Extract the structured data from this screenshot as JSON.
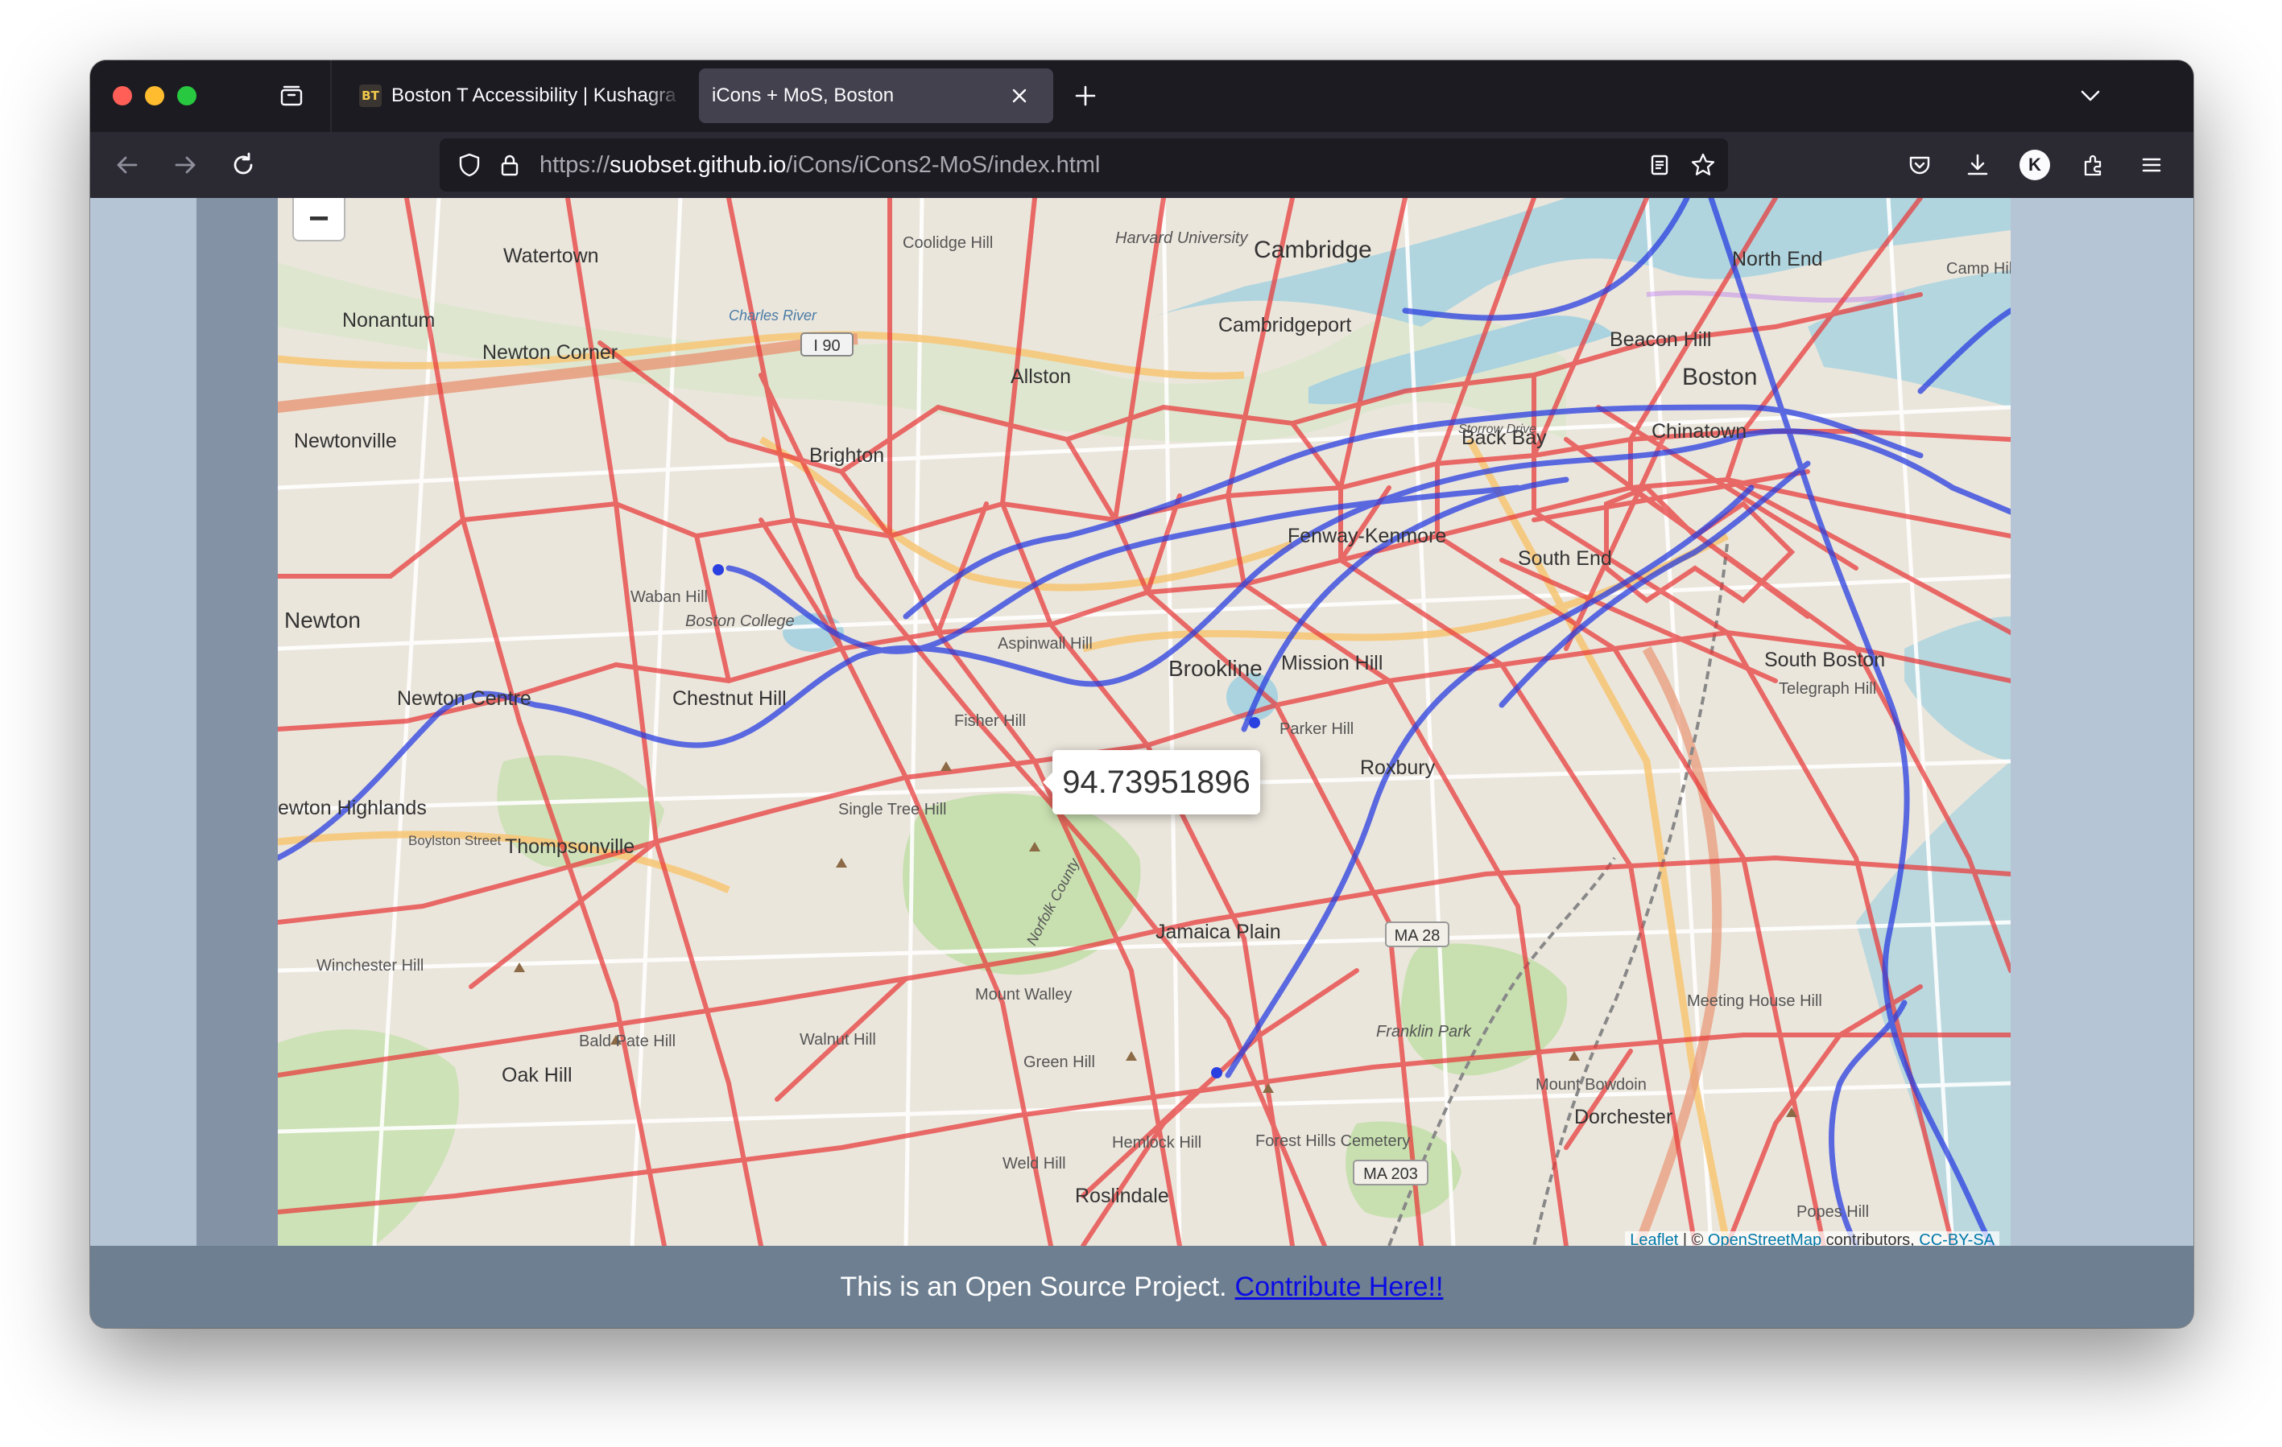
{
  "browser": {
    "tabs": [
      {
        "title": "Boston T Accessibility | Kushagra",
        "favicon": "tab-favicon",
        "active": false
      },
      {
        "title": "iCons + MoS, Boston",
        "active": true
      }
    ],
    "url": {
      "prefix": "https://",
      "host": "suobset.github.io",
      "path": "/iCons/iCons2-MoS/index.html"
    },
    "icons": [
      "tab-overview-icon",
      "new-tab-icon",
      "tab-list-icon",
      "back-icon",
      "forward-icon",
      "reload-icon",
      "shield-icon",
      "lock-icon",
      "reader-view-icon",
      "bookmark-star-icon",
      "pocket-icon",
      "download-icon",
      "account-avatar-icon",
      "extensions-icon",
      "menu-icon"
    ],
    "avatar_letter": "K"
  },
  "map": {
    "zoom_out_label": "−",
    "tooltip_value": "94.73951896",
    "labels": {
      "watertown": "Watertown",
      "nonantum": "Nonantum",
      "newton_corner": "Newton Corner",
      "newtonville": "Newtonville",
      "newton": "Newton",
      "newton_centre": "Newton Centre",
      "newton_highlands": "ewton Highlands",
      "thompsonville": "Thompsonville",
      "chestnut_hill": "Chestnut Hill",
      "brighton": "Brighton",
      "allston": "Allston",
      "cambridge": "Cambridge",
      "cambridgeport": "Cambridgeport",
      "harvard_university": "Harvard University",
      "beacon_hill": "Beacon Hill",
      "north_end": "North End",
      "boston": "Boston",
      "back_bay": "Back Bay",
      "chinatown": "Chinatown",
      "fenway_kenmore": "Fenway-Kenmore",
      "south_end": "South End",
      "brookline": "Brookline",
      "mission_hill": "Mission Hill",
      "roxbury": "Roxbury",
      "south_boston": "South Boston",
      "jamaica_plain": "Jamaica Plain",
      "oak_hill": "Oak Hill",
      "dorchester": "Dorchester",
      "roslindale": "Roslindale",
      "winchester_hill": "Winchester Hill",
      "bald_pate_hill": "Bald Pate Hill",
      "walnut_hill": "Walnut Hill",
      "green_hill": "Green Hill",
      "mount_walley": "Mount Walley",
      "weld_hill": "Weld Hill",
      "hemlock_hill": "Hemlock Hill",
      "forest_hills_cemetery": "Forest Hills Cemetery",
      "franklin_park": "Franklin Park",
      "meeting_house_hill": "Meeting House Hill",
      "mount_bowdoin": "Mount Bowdoin",
      "single_tree_hill": "Single Tree Hill",
      "fisher_hill": "Fisher Hill",
      "aspinwall_hill": "Aspinwall Hill",
      "waban_hill": "Waban Hill",
      "boston_college": "Boston College",
      "coolidge_hill": "Coolidge Hill",
      "parker_hill": "Parker Hill",
      "telegraph_hill": "Telegraph Hill",
      "camp_hill": "Camp Hill",
      "i90": "I 90",
      "ma28": "MA 28",
      "ma203": "MA 203",
      "charles_river": "Charles River",
      "boylston_street": "Boylston Street",
      "storrow_drive": "Storrow Drive",
      "popes_hill": "Popes Hill",
      "norfolk_county": "Norfolk County"
    },
    "attribution": {
      "leaflet": "Leaflet",
      "sep": " | © ",
      "osm": "OpenStreetMap",
      "contrib": " contributors, ",
      "license": "CC-BY-SA"
    }
  },
  "footer": {
    "text": "This is an Open Source Project.",
    "link": "Contribute Here!!"
  },
  "colors": {
    "network_red": "#e8393a",
    "transit_blue": "#2a3fe0",
    "panel": "#8492a6",
    "outer": "#b6c5d6",
    "footer": "#6d7f91"
  }
}
